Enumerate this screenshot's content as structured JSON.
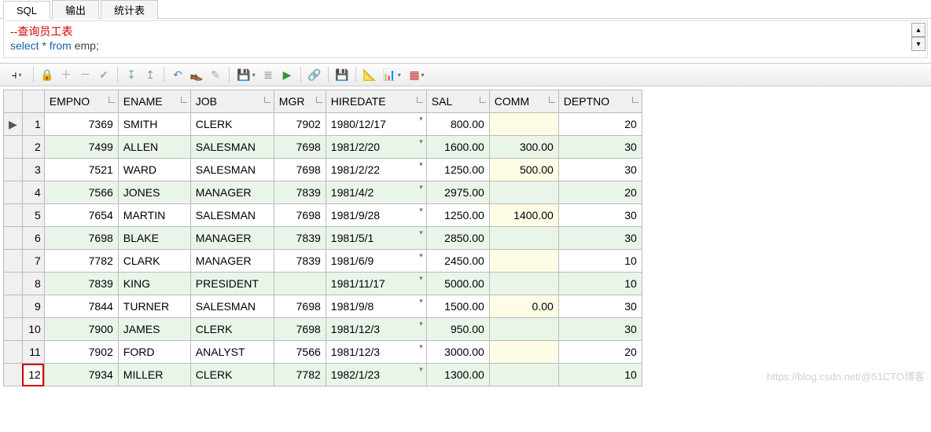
{
  "tabs": {
    "sql": "SQL",
    "output": "输出",
    "stats": "统计表"
  },
  "editor": {
    "comment": "--查询员工表",
    "line": {
      "sel": "select",
      "star": "*",
      "from": "from",
      "tbl": "emp",
      "semi": ";"
    }
  },
  "side_icons": {
    "refresh": "↻",
    "add": "⊕"
  },
  "scroll": {
    "up": "▴",
    "down": "▾"
  },
  "columns": {
    "empno": "EMPNO",
    "ename": "ENAME",
    "job": "JOB",
    "mgr": "MGR",
    "hiredate": "HIREDATE",
    "sal": "SAL",
    "comm": "COMM",
    "deptno": "DEPTNO"
  },
  "rows": [
    {
      "n": "1",
      "empno": "7369",
      "ename": "SMITH",
      "job": "CLERK",
      "mgr": "7902",
      "hiredate": "1980/12/17",
      "sal": "800.00",
      "comm": "",
      "deptno": "20"
    },
    {
      "n": "2",
      "empno": "7499",
      "ename": "ALLEN",
      "job": "SALESMAN",
      "mgr": "7698",
      "hiredate": "1981/2/20",
      "sal": "1600.00",
      "comm": "300.00",
      "deptno": "30"
    },
    {
      "n": "3",
      "empno": "7521",
      "ename": "WARD",
      "job": "SALESMAN",
      "mgr": "7698",
      "hiredate": "1981/2/22",
      "sal": "1250.00",
      "comm": "500.00",
      "deptno": "30"
    },
    {
      "n": "4",
      "empno": "7566",
      "ename": "JONES",
      "job": "MANAGER",
      "mgr": "7839",
      "hiredate": "1981/4/2",
      "sal": "2975.00",
      "comm": "",
      "deptno": "20"
    },
    {
      "n": "5",
      "empno": "7654",
      "ename": "MARTIN",
      "job": "SALESMAN",
      "mgr": "7698",
      "hiredate": "1981/9/28",
      "sal": "1250.00",
      "comm": "1400.00",
      "deptno": "30"
    },
    {
      "n": "6",
      "empno": "7698",
      "ename": "BLAKE",
      "job": "MANAGER",
      "mgr": "7839",
      "hiredate": "1981/5/1",
      "sal": "2850.00",
      "comm": "",
      "deptno": "30"
    },
    {
      "n": "7",
      "empno": "7782",
      "ename": "CLARK",
      "job": "MANAGER",
      "mgr": "7839",
      "hiredate": "1981/6/9",
      "sal": "2450.00",
      "comm": "",
      "deptno": "10"
    },
    {
      "n": "8",
      "empno": "7839",
      "ename": "KING",
      "job": "PRESIDENT",
      "mgr": "",
      "hiredate": "1981/11/17",
      "sal": "5000.00",
      "comm": "",
      "deptno": "10"
    },
    {
      "n": "9",
      "empno": "7844",
      "ename": "TURNER",
      "job": "SALESMAN",
      "mgr": "7698",
      "hiredate": "1981/9/8",
      "sal": "1500.00",
      "comm": "0.00",
      "deptno": "30"
    },
    {
      "n": "10",
      "empno": "7900",
      "ename": "JAMES",
      "job": "CLERK",
      "mgr": "7698",
      "hiredate": "1981/12/3",
      "sal": "950.00",
      "comm": "",
      "deptno": "30"
    },
    {
      "n": "11",
      "empno": "7902",
      "ename": "FORD",
      "job": "ANALYST",
      "mgr": "7566",
      "hiredate": "1981/12/3",
      "sal": "3000.00",
      "comm": "",
      "deptno": "20"
    },
    {
      "n": "12",
      "empno": "7934",
      "ename": "MILLER",
      "job": "CLERK",
      "mgr": "7782",
      "hiredate": "1982/1/23",
      "sal": "1300.00",
      "comm": "",
      "deptno": "10"
    }
  ],
  "selected_row": 12,
  "pointer_row": 1,
  "watermark": "https://blog.csdn.net/@51CTO博客",
  "toolbar_icons": {
    "dock": "⫞",
    "lock": "🔒",
    "add": "＋",
    "del": "－",
    "ok": "✔",
    "down": "↧",
    "up": "↥",
    "undo": "↶",
    "find": "👞",
    "edit": "✎",
    "save": "💾",
    "props": "≣",
    "run": "▶",
    "link": "🔗",
    "disk": "💾",
    "calc": "📐",
    "chart": "📊",
    "grid": "▦"
  }
}
